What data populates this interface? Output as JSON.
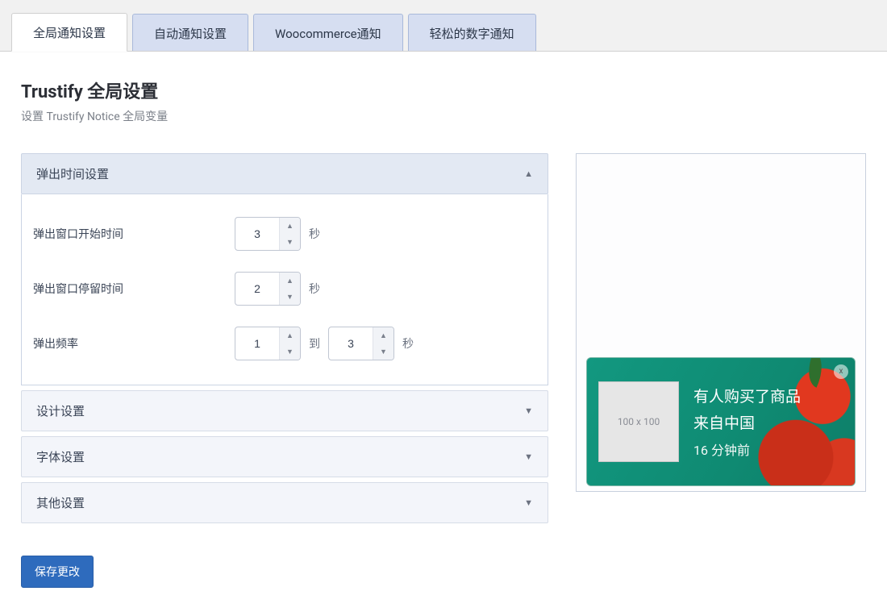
{
  "tabs": [
    {
      "label": "全局通知设置",
      "active": true
    },
    {
      "label": "自动通知设置",
      "active": false
    },
    {
      "label": "Woocommerce通知",
      "active": false
    },
    {
      "label": "轻松的数字通知",
      "active": false
    }
  ],
  "page": {
    "title": "Trustify 全局设置",
    "subtitle": "设置 Trustify Notice 全局变量"
  },
  "sections": {
    "popup_time": {
      "title": "弹出时间设置"
    },
    "design": {
      "title": "设计设置"
    },
    "font": {
      "title": "字体设置"
    },
    "other": {
      "title": "其他设置"
    }
  },
  "fields": {
    "start_time": {
      "label": "弹出窗口开始时间",
      "value": "3",
      "unit": "秒"
    },
    "stay_time": {
      "label": "弹出窗口停留时间",
      "value": "2",
      "unit": "秒"
    },
    "frequency": {
      "label": "弹出频率",
      "from": "1",
      "to": "3",
      "between": "到",
      "unit": "秒"
    }
  },
  "save_btn": "保存更改",
  "preview": {
    "thumb": "100 x 100",
    "line1": "有人购买了商品",
    "line2": "来自中国",
    "line3": "16 分钟前",
    "close": "x"
  }
}
